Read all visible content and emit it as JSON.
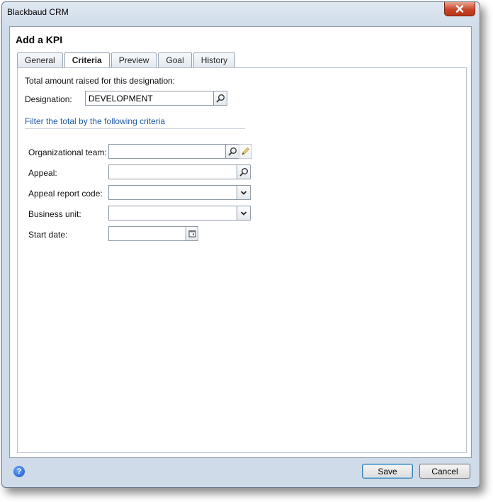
{
  "window": {
    "title": "Blackbaud CRM"
  },
  "dialog": {
    "title": "Add a KPI",
    "tabs": [
      {
        "label": "General"
      },
      {
        "label": "Criteria",
        "active": true
      },
      {
        "label": "Preview"
      },
      {
        "label": "Goal"
      },
      {
        "label": "History"
      }
    ]
  },
  "criteria": {
    "intro": "Total amount raised for this designation:",
    "designation": {
      "label": "Designation:",
      "value": "DEVELOPMENT"
    },
    "filter_heading": "Filter the total by the following criteria",
    "fields": {
      "organizational_team": {
        "label": "Organizational team:",
        "value": ""
      },
      "appeal": {
        "label": "Appeal:",
        "value": ""
      },
      "appeal_report_code": {
        "label": "Appeal report code:",
        "value": ""
      },
      "business_unit": {
        "label": "Business unit:",
        "value": ""
      },
      "start_date": {
        "label": "Start date:",
        "value": ""
      }
    }
  },
  "footer": {
    "save_label": "Save",
    "cancel_label": "Cancel",
    "help_glyph": "?"
  },
  "icons": {
    "search": "magnifier-icon",
    "edit": "pencil-icon",
    "dropdown": "chevron-down-icon",
    "calendar": "calendar-icon",
    "close": "close-icon",
    "help": "help-icon"
  },
  "colors": {
    "link": "#1f5aa6",
    "close_button": "#c8452a",
    "help": "#1950c4"
  }
}
